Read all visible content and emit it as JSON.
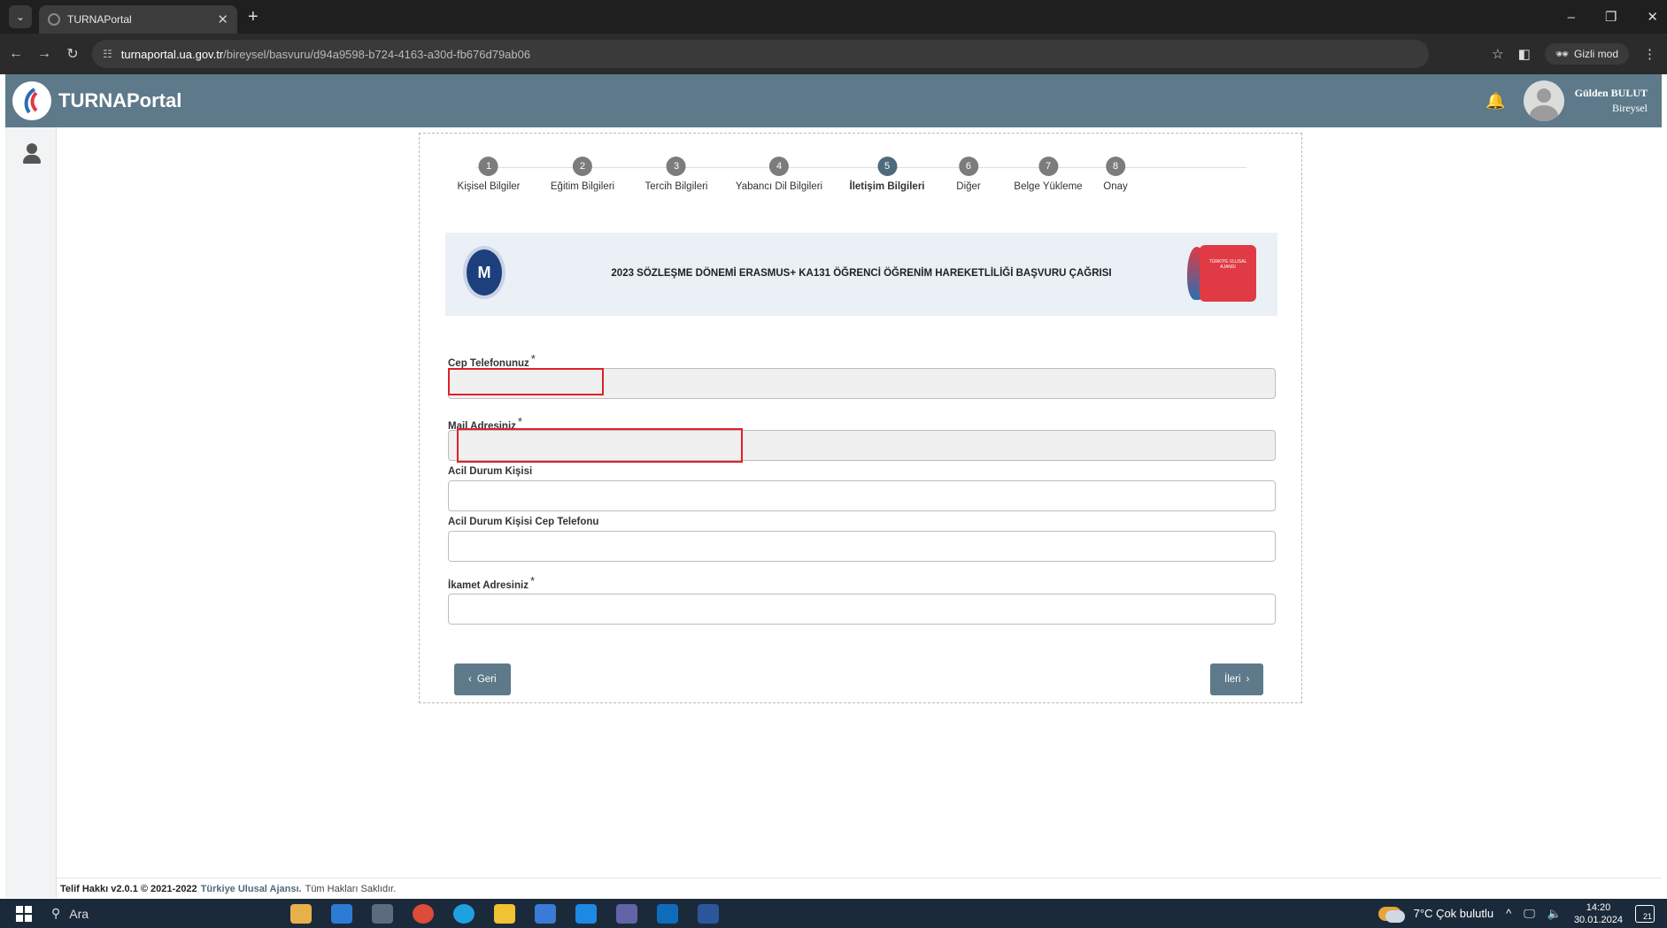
{
  "browser": {
    "tab_title": "TURNAPortal",
    "url_host": "turnaportal.ua.gov.tr",
    "url_path": "/bireysel/basvuru/d94a9598-b724-4163-a30d-fb676d79ab06",
    "incognito_label": "Gizli mod"
  },
  "header": {
    "app_name": "TURNAPortal",
    "user_name": "Gülden BULUT",
    "user_role": "Bireysel"
  },
  "steps": [
    {
      "num": "1",
      "label": "Kişisel Bilgiler"
    },
    {
      "num": "2",
      "label": "Eğitim Bilgileri"
    },
    {
      "num": "3",
      "label": "Tercih Bilgileri"
    },
    {
      "num": "4",
      "label": "Yabancı Dil Bilgileri"
    },
    {
      "num": "5",
      "label": "İletişim Bilgileri"
    },
    {
      "num": "6",
      "label": "Diğer"
    },
    {
      "num": "7",
      "label": "Belge Yükleme"
    },
    {
      "num": "8",
      "label": "Onay"
    }
  ],
  "active_step": 5,
  "banner": {
    "title": "2023 SÖZLEŞME DÖNEMİ ERASMUS+ KA131 ÖĞRENCİ ÖĞRENİM HAREKETLİLİĞİ BAŞVURU ÇAĞRISI",
    "ua_logo_text": "TÜRKİYE ULUSAL AJANSI"
  },
  "form": {
    "phone_label": "Cep Telefonunuz",
    "phone_value": "",
    "mail_label": "Mail Adresiniz",
    "mail_value": "",
    "emergency_contact_label": "Acil Durum Kişisi",
    "emergency_contact_value": "",
    "emergency_phone_label": "Acil Durum Kişisi Cep Telefonu",
    "emergency_phone_value": "",
    "address_label": "İkamet Adresiniz",
    "address_value": "",
    "required_mark": "*"
  },
  "buttons": {
    "back": "Geri",
    "next": "İleri"
  },
  "footer": {
    "version": "Telif Hakkı v2.0.1 © 2021-2022",
    "agency": "Türkiye Ulusal Ajansı.",
    "rights": "Tüm Hakları Saklıdır."
  },
  "taskbar": {
    "search_label": "Ara",
    "weather": "7°C  Çok bulutlu",
    "time": "14:20",
    "date": "30.01.2024",
    "notification_count": "21"
  },
  "colors": {
    "header": "#5e7a8a",
    "active_step": "#4e6b7c",
    "annotation_red": "#e0202a"
  }
}
